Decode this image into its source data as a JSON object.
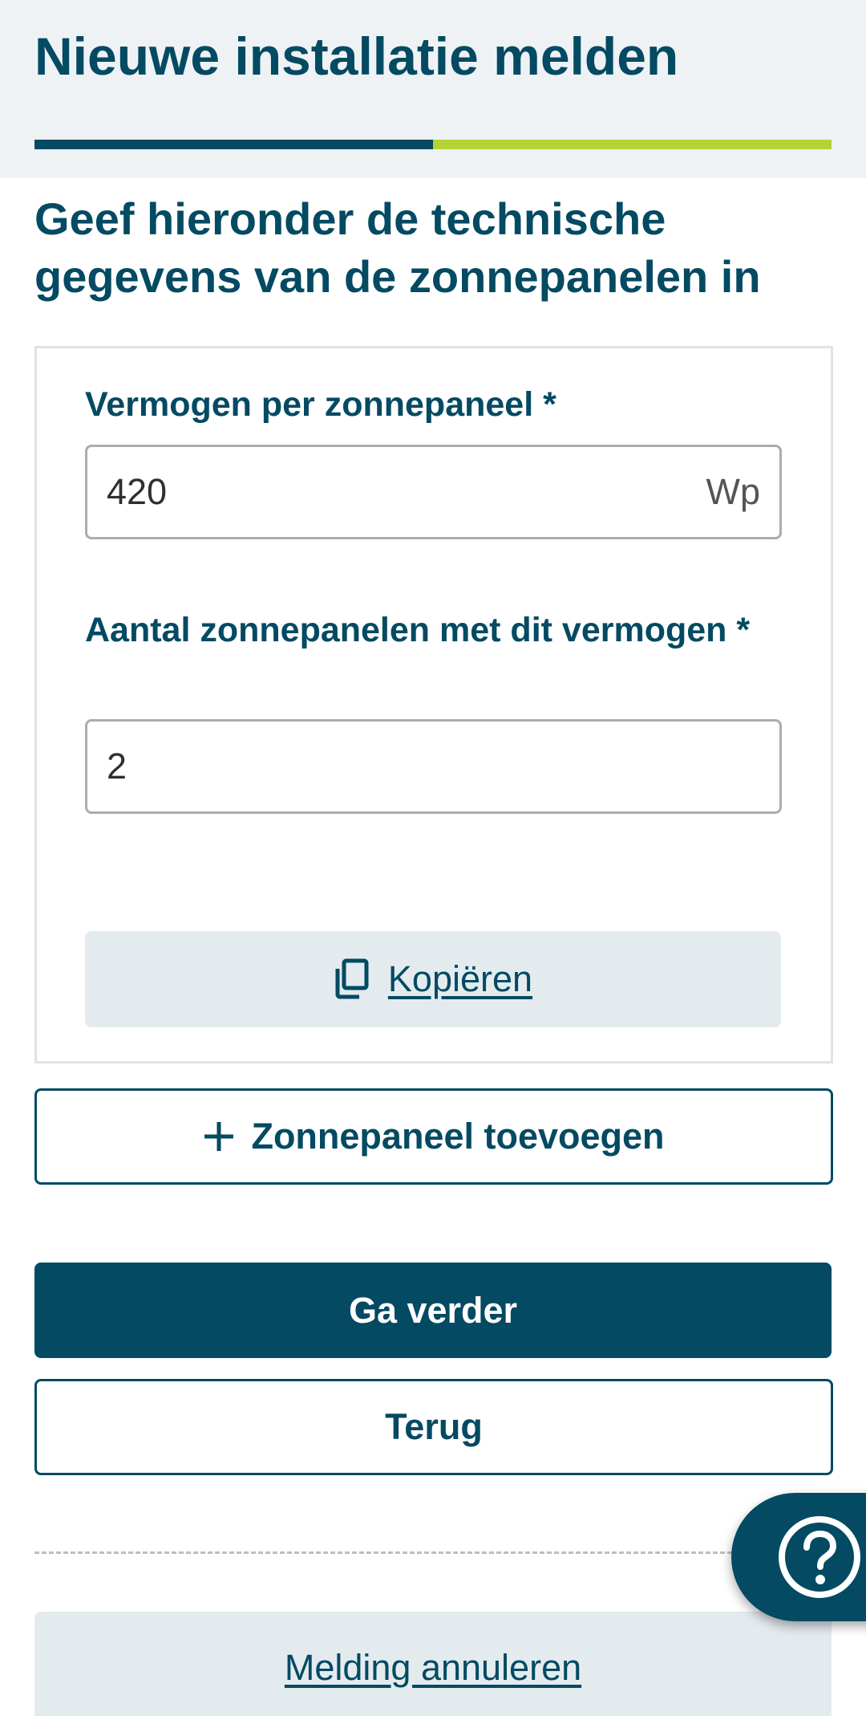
{
  "header": {
    "title": "Nieuwe installatie melden",
    "progress_fraction": 0.5,
    "progress_color": "#034a62",
    "progress_track_color": "#b5d334"
  },
  "section": {
    "heading": "Geef hieronder de technische gegevens van de zonnepanelen in"
  },
  "panel": {
    "power_label": "Vermogen per zonnepaneel *",
    "power_value": "420",
    "power_unit": "Wp",
    "count_label": "Aantal zonnepanelen met dit vermogen *",
    "count_value": "2",
    "copy_label": "Kopiëren",
    "copy_icon": "copy-icon"
  },
  "actions": {
    "add_panel_label": "Zonnepaneel toevoegen",
    "add_icon": "plus-icon",
    "continue_label": "Ga verder",
    "back_label": "Terug",
    "cancel_label": "Melding annuleren"
  },
  "help": {
    "icon": "question-circle-icon"
  },
  "colors": {
    "brand": "#034a62",
    "accent": "#b5d334",
    "header_bg": "#eff2f5",
    "secondary_bg": "#e4ebef"
  }
}
